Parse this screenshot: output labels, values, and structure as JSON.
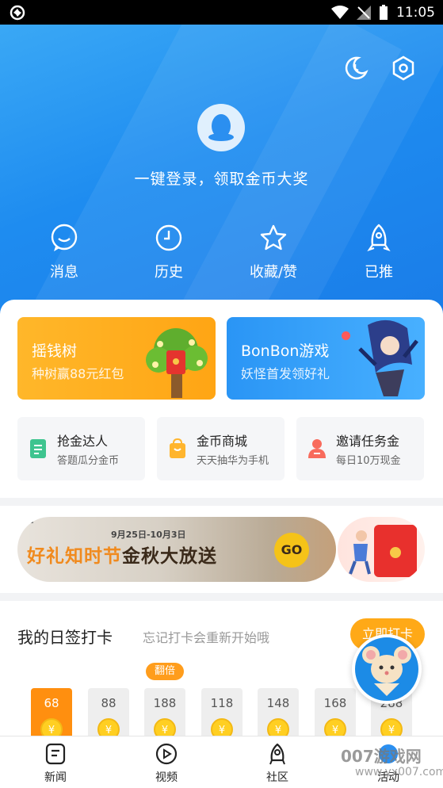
{
  "status_bar": {
    "time": "11:05"
  },
  "hero": {
    "login_text": "一键登录，领取金币大奖",
    "quick_actions": [
      {
        "label": "消息",
        "icon": "message-icon"
      },
      {
        "label": "历史",
        "icon": "clock-icon"
      },
      {
        "label": "收藏/赞",
        "icon": "star-icon"
      },
      {
        "label": "已推",
        "icon": "rocket-icon"
      }
    ]
  },
  "promos": [
    {
      "title": "摇钱树",
      "subtitle": "种树赢88元红包"
    },
    {
      "title": "BonBon游戏",
      "subtitle": "妖怪首发领好礼"
    }
  ],
  "mini_cards": [
    {
      "title": "抢金达人",
      "subtitle": "答题瓜分金币",
      "icon": "quiz-icon"
    },
    {
      "title": "金币商城",
      "subtitle": "天天抽华为手机",
      "icon": "shop-bag-icon"
    },
    {
      "title": "邀请任务金",
      "subtitle": "每日10万现金",
      "icon": "invite-people-icon"
    }
  ],
  "banner": {
    "date": "9月25日-10月3日",
    "headline_a": "好礼知时节",
    "headline_b": "金秋大放送",
    "go": "GO"
  },
  "checkin": {
    "title": "我的日签打卡",
    "subtitle": "忘记打卡会重新开始哦",
    "button": "立即打卡",
    "double_tag": "翻倍",
    "coin_symbol": "¥",
    "days": [
      68,
      88,
      188,
      118,
      148,
      168,
      288
    ]
  },
  "bottom_nav": [
    {
      "label": "新闻",
      "icon": "news-icon"
    },
    {
      "label": "视频",
      "icon": "play-icon"
    },
    {
      "label": "社区",
      "icon": "community-icon"
    },
    {
      "label": "活动",
      "icon": "activity-icon"
    }
  ],
  "watermark": {
    "text": "007游戏网",
    "url": "www.yx007.com"
  }
}
